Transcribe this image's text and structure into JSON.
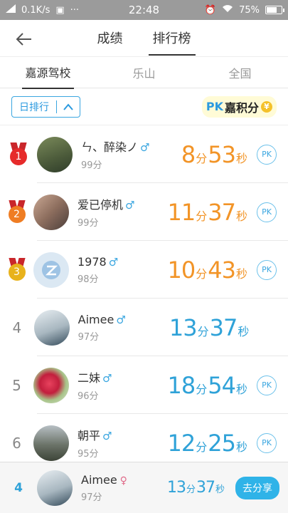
{
  "status_bar": {
    "net_speed": "0.1K/s",
    "time": "22:48",
    "battery": "75%",
    "battery_level": 0.75
  },
  "nav": {
    "tabs": [
      {
        "label": "成绩"
      },
      {
        "label": "排行榜"
      }
    ],
    "active_tab": "排行榜"
  },
  "region_tabs": [
    {
      "label": "嘉源驾校"
    },
    {
      "label": "乐山"
    },
    {
      "label": "全国"
    }
  ],
  "filter": {
    "period_label": "日排行",
    "pk_text": "PK",
    "pk_title": "嘉积分",
    "coin": "¥"
  },
  "rows": [
    {
      "rank": "1",
      "name": "ㄣ、醉染ノ",
      "score": "99分",
      "min": "8",
      "sec": "53",
      "pk": "PK"
    },
    {
      "rank": "2",
      "name": "爱已停机",
      "score": "99分",
      "min": "11",
      "sec": "37",
      "pk": "PK"
    },
    {
      "rank": "3",
      "name": "1978",
      "score": "98分",
      "min": "10",
      "sec": "43",
      "pk": "PK"
    },
    {
      "rank": "4",
      "name": "Aimee",
      "score": "97分",
      "min": "13",
      "sec": "37",
      "pk": ""
    },
    {
      "rank": "5",
      "name": "二妹",
      "score": "96分",
      "min": "18",
      "sec": "54",
      "pk": "PK"
    },
    {
      "rank": "6",
      "name": "朝平",
      "score": "95分",
      "min": "12",
      "sec": "25",
      "pk": "PK"
    }
  ],
  "units": {
    "min": "分",
    "sec": "秒"
  },
  "gender_male": "♂",
  "gender_female": "♀",
  "footer": {
    "rank": "4",
    "name": "Aimee",
    "score": "97分",
    "min": "13",
    "sec": "37",
    "share_label": "去分享"
  },
  "colors": {
    "accent": "#2fa2d8",
    "top3": "#f29427",
    "gold": "#e8b21c",
    "silver": "#ef7d23",
    "bronze_red": "#e62b2b"
  }
}
